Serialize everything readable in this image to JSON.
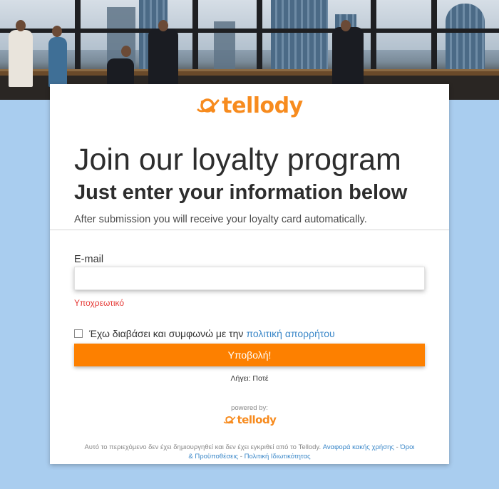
{
  "brand": {
    "name": "tellody",
    "color": "#f78b1e"
  },
  "hero": {
    "icon": "office-photo"
  },
  "form": {
    "title": "Join our loyalty program",
    "subtitle": "Just enter your information below",
    "description": "After submission you will receive your loyalty card automatically.",
    "email_label": "E-mail",
    "email_value": "",
    "email_placeholder": "",
    "required_text": "Υποχρεωτικό",
    "consent_text": "Έχω διαβάσει και συμφωνώ με την",
    "consent_link": "πολιτική απορρήτου",
    "submit_label": "Υποβολή!",
    "expires_text": "Λήγει: Ποτέ"
  },
  "powered": {
    "label": "powered by:",
    "brand": "tellody"
  },
  "footer": {
    "text": "Αυτό το περιεχόμενο δεν έχει δημιουργηθεί και δεν έχει εγκριθεί από το Tellody.",
    "report_link": "Αναφορά κακής χρήσης",
    "sep1": " - ",
    "terms_link": "Όροι & Προϋποθέσεις",
    "sep2": " - ",
    "privacy_link": "Πολιτική Ιδιωτικότητας"
  },
  "colors": {
    "accent": "#fd8000",
    "link": "#3a87c8",
    "error": "#e53935",
    "background": "#a9cdef"
  }
}
